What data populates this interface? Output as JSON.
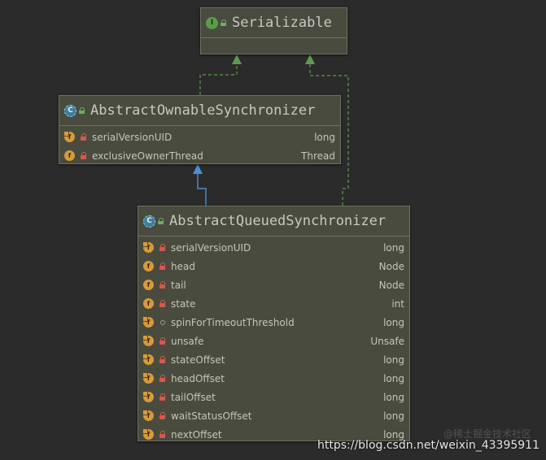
{
  "colors": {
    "background": "#2b2b2b",
    "node_fill": "#4a4b3f",
    "realization_arrow": "#5f9a4e",
    "generalization_arrow": "#4a8fd4"
  },
  "nodes": {
    "serializable": {
      "title": "Serializable",
      "kind": "interface",
      "icon_letter": "I",
      "fields": []
    },
    "aos": {
      "title": "AbstractOwnableSynchronizer",
      "kind": "abstract-class",
      "icon_letter": "C",
      "fields": [
        {
          "name": "serialVersionUID",
          "type": "long",
          "static": true,
          "visibility": "private"
        },
        {
          "name": "exclusiveOwnerThread",
          "type": "Thread",
          "static": false,
          "visibility": "private"
        }
      ]
    },
    "aqs": {
      "title": "AbstractQueuedSynchronizer",
      "kind": "abstract-class",
      "icon_letter": "C",
      "fields": [
        {
          "name": "serialVersionUID",
          "type": "long",
          "static": true,
          "visibility": "private"
        },
        {
          "name": "head",
          "type": "Node",
          "static": false,
          "visibility": "private"
        },
        {
          "name": "tail",
          "type": "Node",
          "static": false,
          "visibility": "private"
        },
        {
          "name": "state",
          "type": "int",
          "static": false,
          "visibility": "private"
        },
        {
          "name": "spinForTimeoutThreshold",
          "type": "long",
          "static": true,
          "visibility": "package"
        },
        {
          "name": "unsafe",
          "type": "Unsafe",
          "static": true,
          "visibility": "private"
        },
        {
          "name": "stateOffset",
          "type": "long",
          "static": true,
          "visibility": "private"
        },
        {
          "name": "headOffset",
          "type": "long",
          "static": true,
          "visibility": "private"
        },
        {
          "name": "tailOffset",
          "type": "long",
          "static": true,
          "visibility": "private"
        },
        {
          "name": "waitStatusOffset",
          "type": "long",
          "static": true,
          "visibility": "private"
        },
        {
          "name": "nextOffset",
          "type": "long",
          "static": true,
          "visibility": "private"
        }
      ]
    }
  },
  "edges": [
    {
      "from": "aos",
      "to": "serializable",
      "kind": "realization"
    },
    {
      "from": "aqs",
      "to": "serializable",
      "kind": "realization"
    },
    {
      "from": "aqs",
      "to": "aos",
      "kind": "generalization"
    }
  ],
  "field_icon_letter": "f",
  "watermark": {
    "url": "https://blog.csdn.net/weixin_43395911",
    "faint": "@稀土掘金技术社区"
  }
}
